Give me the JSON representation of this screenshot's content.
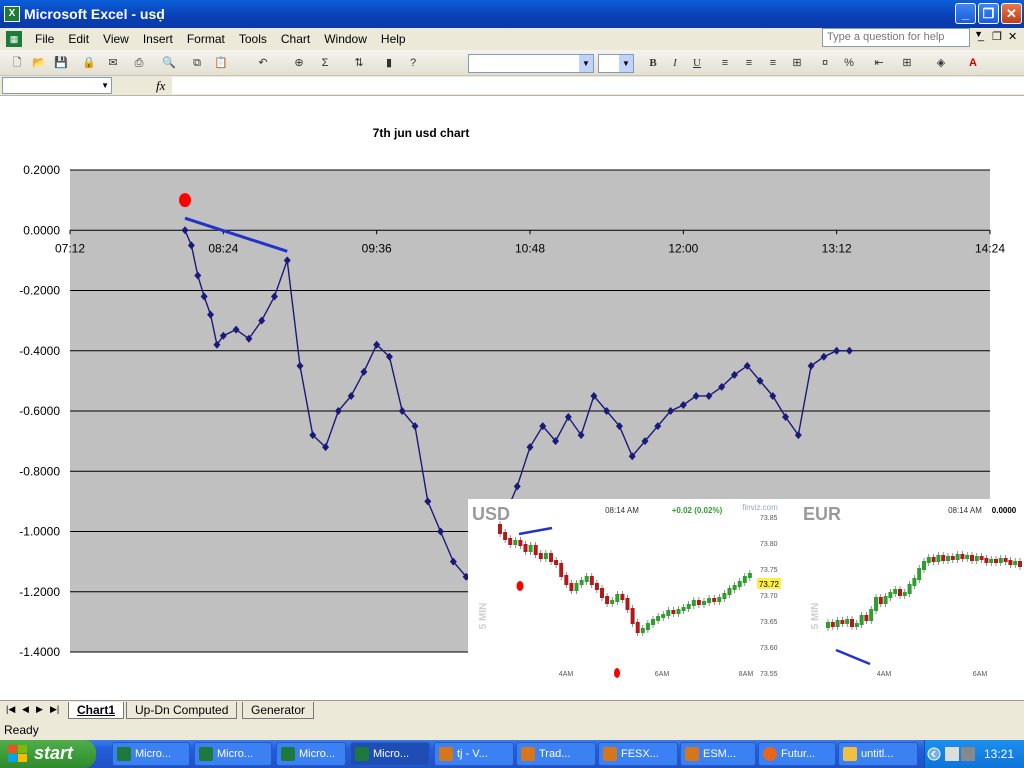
{
  "window": {
    "title": "Microsoft Excel - usḍ"
  },
  "menu": [
    "File",
    "Edit",
    "View",
    "Insert",
    "Format",
    "Tools",
    "Chart",
    "Window",
    "Help"
  ],
  "help_placeholder": "Type a question for help",
  "sheet_tabs": [
    "Chart1",
    "Up-Dn Computed",
    "Generator"
  ],
  "status": "Ready",
  "taskbar": {
    "start": "start",
    "tasks": [
      "Micro...",
      "Micro...",
      "Micro...",
      "Micro...",
      "tj - V...",
      "Trad...",
      "FESX...",
      "ESM...",
      "Futur...",
      "untitl..."
    ],
    "clock": "13:21"
  },
  "colors": {
    "series": "#1a1a7a",
    "plot_bg": "#c0c0c0",
    "marker_red": "#ff0000",
    "trend_blue": "#2233cc",
    "up_candle": "#2e9e2e",
    "down_candle": "#b21a1a"
  },
  "chart_data": {
    "type": "line",
    "title": "7th jun usd chart",
    "xlabel": "",
    "ylabel": "",
    "x_ticks": [
      "07:12",
      "08:24",
      "09:36",
      "10:48",
      "12:00",
      "13:12",
      "14:24"
    ],
    "y_ticks": [
      "0.2000",
      "0.0000",
      "-0.2000",
      "-0.4000",
      "-0.6000",
      "-0.8000",
      "-1.0000",
      "-1.2000",
      "-1.4000"
    ],
    "xlim": [
      "07:12",
      "14:24"
    ],
    "ylim": [
      -1.4,
      0.2
    ],
    "grid": "horizontal",
    "series": [
      {
        "x": [
          "08:06",
          "08:09",
          "08:12",
          "08:15",
          "08:18",
          "08:21",
          "08:24",
          "08:30",
          "08:36",
          "08:42",
          "08:48",
          "08:54",
          "09:00",
          "09:06",
          "09:12",
          "09:18",
          "09:24",
          "09:30",
          "09:36",
          "09:42",
          "09:48",
          "09:54",
          "10:00",
          "10:06",
          "10:12",
          "10:18",
          "10:24",
          "10:30",
          "10:36",
          "10:42",
          "10:48",
          "10:54",
          "11:00",
          "11:06",
          "11:12",
          "11:18",
          "11:24",
          "11:30",
          "11:36",
          "11:42",
          "11:48",
          "11:54",
          "12:00",
          "12:06",
          "12:12",
          "12:18",
          "12:24",
          "12:30",
          "12:36",
          "12:42",
          "12:48",
          "12:54",
          "13:00",
          "13:06",
          "13:12",
          "13:18"
        ],
        "y": [
          0.0,
          -0.05,
          -0.15,
          -0.22,
          -0.28,
          -0.38,
          -0.35,
          -0.33,
          -0.36,
          -0.3,
          -0.22,
          -0.1,
          -0.45,
          -0.68,
          -0.72,
          -0.6,
          -0.55,
          -0.47,
          -0.38,
          -0.42,
          -0.6,
          -0.65,
          -0.9,
          -1.0,
          -1.1,
          -1.15,
          -1.2,
          -1.05,
          -0.95,
          -0.85,
          -0.72,
          -0.65,
          -0.7,
          -0.62,
          -0.68,
          -0.55,
          -0.6,
          -0.65,
          -0.75,
          -0.7,
          -0.65,
          -0.6,
          -0.58,
          -0.55,
          -0.55,
          -0.52,
          -0.48,
          -0.45,
          -0.5,
          -0.55,
          -0.62,
          -0.68,
          -0.45,
          -0.42,
          -0.4,
          -0.4
        ]
      }
    ],
    "annotations": [
      {
        "type": "dot",
        "x": "08:06",
        "y": 0.1
      },
      {
        "type": "dot",
        "x": "10:24",
        "y": -1.05
      },
      {
        "type": "trendline",
        "x": [
          "08:06",
          "08:54"
        ],
        "y": [
          0.04,
          -0.07
        ]
      }
    ]
  },
  "inset_usd": {
    "title": "USD",
    "side_label": "5 MIN",
    "time": "08:14 AM",
    "change": "+0.02 (0.02%)",
    "source": "finviz.com",
    "price_label": "73.72",
    "y_ticks": [
      "73.85",
      "73.80",
      "73.75",
      "73.70",
      "73.65",
      "73.60",
      "73.55"
    ],
    "x_ticks": [
      "4AM",
      "6AM",
      "8AM"
    ]
  },
  "inset_eur": {
    "title": "EUR",
    "side_label": "5 MIN",
    "time": "08:14 AM",
    "change": "0.0000",
    "x_ticks": [
      "4AM",
      "6AM"
    ]
  }
}
